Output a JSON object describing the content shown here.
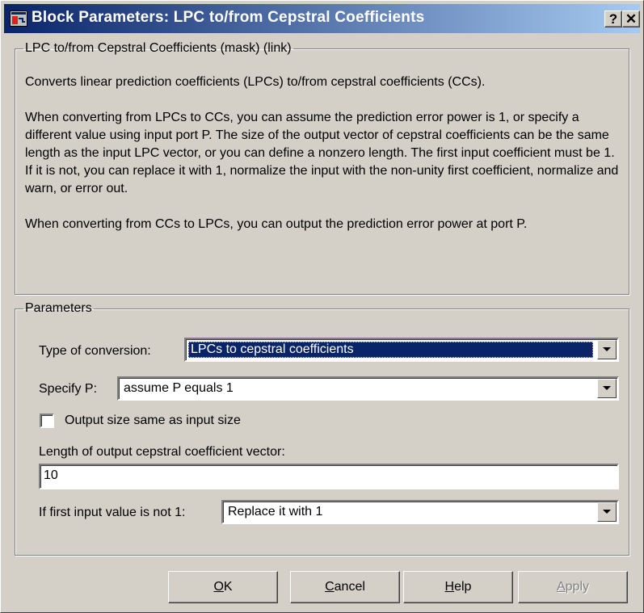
{
  "window": {
    "title": "Block Parameters: LPC to/from Cepstral Coefficients",
    "help_button": "?",
    "close_button": "✕"
  },
  "description": {
    "group_title": "LPC to/from Cepstral Coefficients (mask) (link)",
    "paragraphs": [
      "Converts linear prediction coefficients (LPCs) to/from cepstral coefficients (CCs).",
      "When converting from LPCs to CCs, you can assume the prediction error power is 1, or specify a different value using input port P. The size of the output vector of cepstral coefficients can be the same length as the input LPC vector, or you can define a nonzero length. The first input coefficient must be 1. If it is not, you can replace it with 1, normalize the input with the non-unity first coefficient, normalize and warn, or error out.",
      "When converting from CCs to LPCs, you can output the prediction error power at port P."
    ]
  },
  "parameters": {
    "group_title": "Parameters",
    "conversion_label": "Type of conversion:",
    "conversion_value": "LPCs to cepstral coefficients",
    "specify_p_label": "Specify P:",
    "specify_p_value": "assume P equals 1",
    "output_size_label": "Output size same as input size",
    "output_size_checked": false,
    "length_label": "Length of output cepstral coefficient vector:",
    "length_value": "10",
    "first_value_label": "If first input value is not 1:",
    "first_value_value": "Replace it with 1"
  },
  "buttons": {
    "ok": {
      "mnemonic": "O",
      "rest": "K"
    },
    "cancel": {
      "mnemonic": "C",
      "rest": "ancel"
    },
    "help": {
      "mnemonic": "H",
      "rest": "elp"
    },
    "apply": {
      "mnemonic": "A",
      "rest": "pply"
    }
  },
  "colors": {
    "titlebar_start": "#0a246a",
    "titlebar_end": "#a6caf0",
    "face": "#d4d0c8",
    "selection": "#0a246a"
  },
  "icons": [
    "simulink-block-icon",
    "help-icon",
    "close-icon",
    "dropdown-arrow-icon"
  ]
}
